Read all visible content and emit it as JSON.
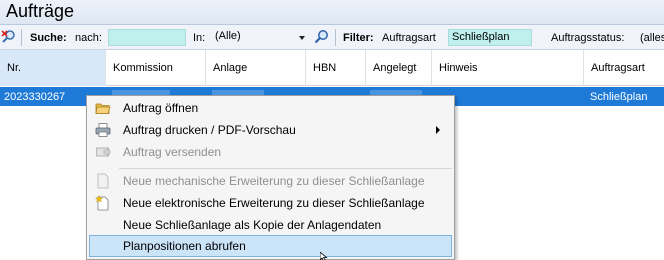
{
  "window": {
    "title": "Aufträge"
  },
  "toolbar": {
    "search_label": "Suche:",
    "nach_label": "nach:",
    "in_label": "In:",
    "in_value": "(Alle)",
    "filter_label": "Filter:",
    "auftragsart_label": "Auftragsart",
    "auftragsart_value": "Schließplan",
    "auftragsstatus_label": "Auftragsstatus:",
    "auftragsstatus_value": "(alles"
  },
  "grid": {
    "columns": [
      "Nr.",
      "Kommission",
      "Anlage",
      "HBN",
      "Angelegt",
      "Hinweis",
      "Auftragsart"
    ],
    "rows": [
      {
        "nr": "2023330267",
        "auftragsart": "Schließplan"
      }
    ],
    "selection_color": "#1e7ad6"
  },
  "context_menu": {
    "items": [
      {
        "label": "Auftrag öffnen",
        "icon": "open-folder-icon",
        "enabled": true
      },
      {
        "label": "Auftrag drucken / PDF-Vorschau",
        "icon": "printer-icon",
        "enabled": true,
        "submenu": true
      },
      {
        "label": "Auftrag versenden",
        "icon": "send-icon",
        "enabled": false
      },
      {
        "label": "Neue mechanische Erweiterung zu dieser Schließanlage",
        "icon": "document-icon",
        "enabled": false
      },
      {
        "label": "Neue elektronische Erweiterung zu dieser Schließanlage",
        "icon": "new-document-icon",
        "enabled": true
      },
      {
        "label": "Neue Schließanlage als Kopie der Anlagendaten",
        "icon": "",
        "enabled": true
      },
      {
        "label": "Planpositionen abrufen",
        "icon": "",
        "enabled": true,
        "highlighted": true
      }
    ]
  }
}
